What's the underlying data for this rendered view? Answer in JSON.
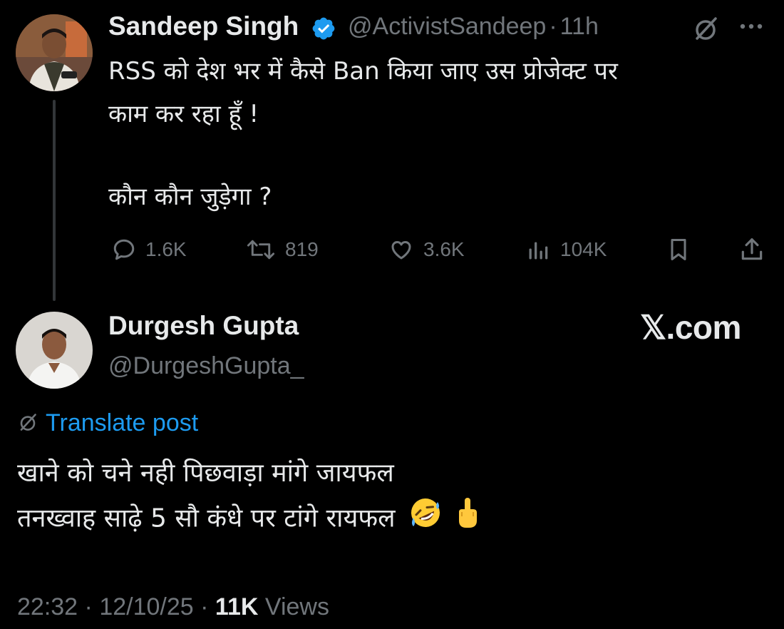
{
  "tweet": {
    "author_name": "Sandeep Singh",
    "author_handle": "@ActivistSandeep",
    "separator": "·",
    "time_ago": "11h",
    "text_line1": "RSS को देश भर में कैसे Ban किया जाए उस प्रोजेक्ट पर",
    "text_line2": "काम कर रहा हूँ !",
    "text_line3": "कौन कौन जुड़ेगा ?",
    "actions": {
      "replies": "1.6K",
      "reposts": "819",
      "likes": "3.6K",
      "views": "104K"
    },
    "icons": {
      "verified": "verified-badge-icon",
      "grok": "grok-icon",
      "more": "more-icon",
      "reply": "reply-icon",
      "repost": "repost-icon",
      "like": "heart-icon",
      "views": "views-icon",
      "bookmark": "bookmark-icon",
      "share": "share-icon"
    }
  },
  "reply": {
    "author_name": "Durgesh Gupta",
    "author_handle": "@DurgeshGupta_",
    "watermark": "𝕏.com",
    "translate_label": "Translate post",
    "text_line1": "खाने को चने नही पिछवाड़ा मांगे जायफल",
    "text_line2": "तनख्वाह साढ़े 5 सौ कंधे पर टांगे रायफल",
    "timestamp_time": "22:32",
    "timestamp_sep1": "·",
    "timestamp_date": "12/10/25",
    "timestamp_sep2": "·",
    "views_count": "11K",
    "views_label": "Views"
  },
  "colors": {
    "background": "#000000",
    "text": "#e7e9ea",
    "muted": "#71767b",
    "accent": "#1d9bf0"
  }
}
